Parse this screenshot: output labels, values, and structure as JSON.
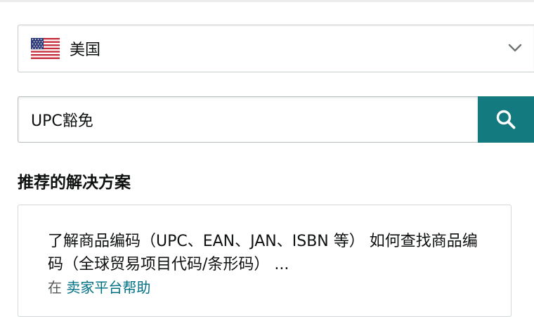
{
  "country_selector": {
    "flag_icon": "us-flag-icon",
    "selected_country": "美国",
    "chevron_icon": "chevron-down-icon"
  },
  "search": {
    "value": "UPC豁免",
    "button_icon": "search-icon"
  },
  "recommendations": {
    "heading": "推荐的解决方案",
    "results": [
      {
        "title": "了解商品编码（UPC、EAN、JAN、ISBN 等） 如何查找商品编码（全球贸易项目代码/条形码） ...",
        "source_prefix": "在",
        "source_name": "卖家平台帮助"
      }
    ]
  },
  "colors": {
    "search_button_bg": "#137a80",
    "link": "#007185",
    "text": "#0f1111",
    "muted_text": "#565959",
    "border": "#d5d9d9"
  }
}
